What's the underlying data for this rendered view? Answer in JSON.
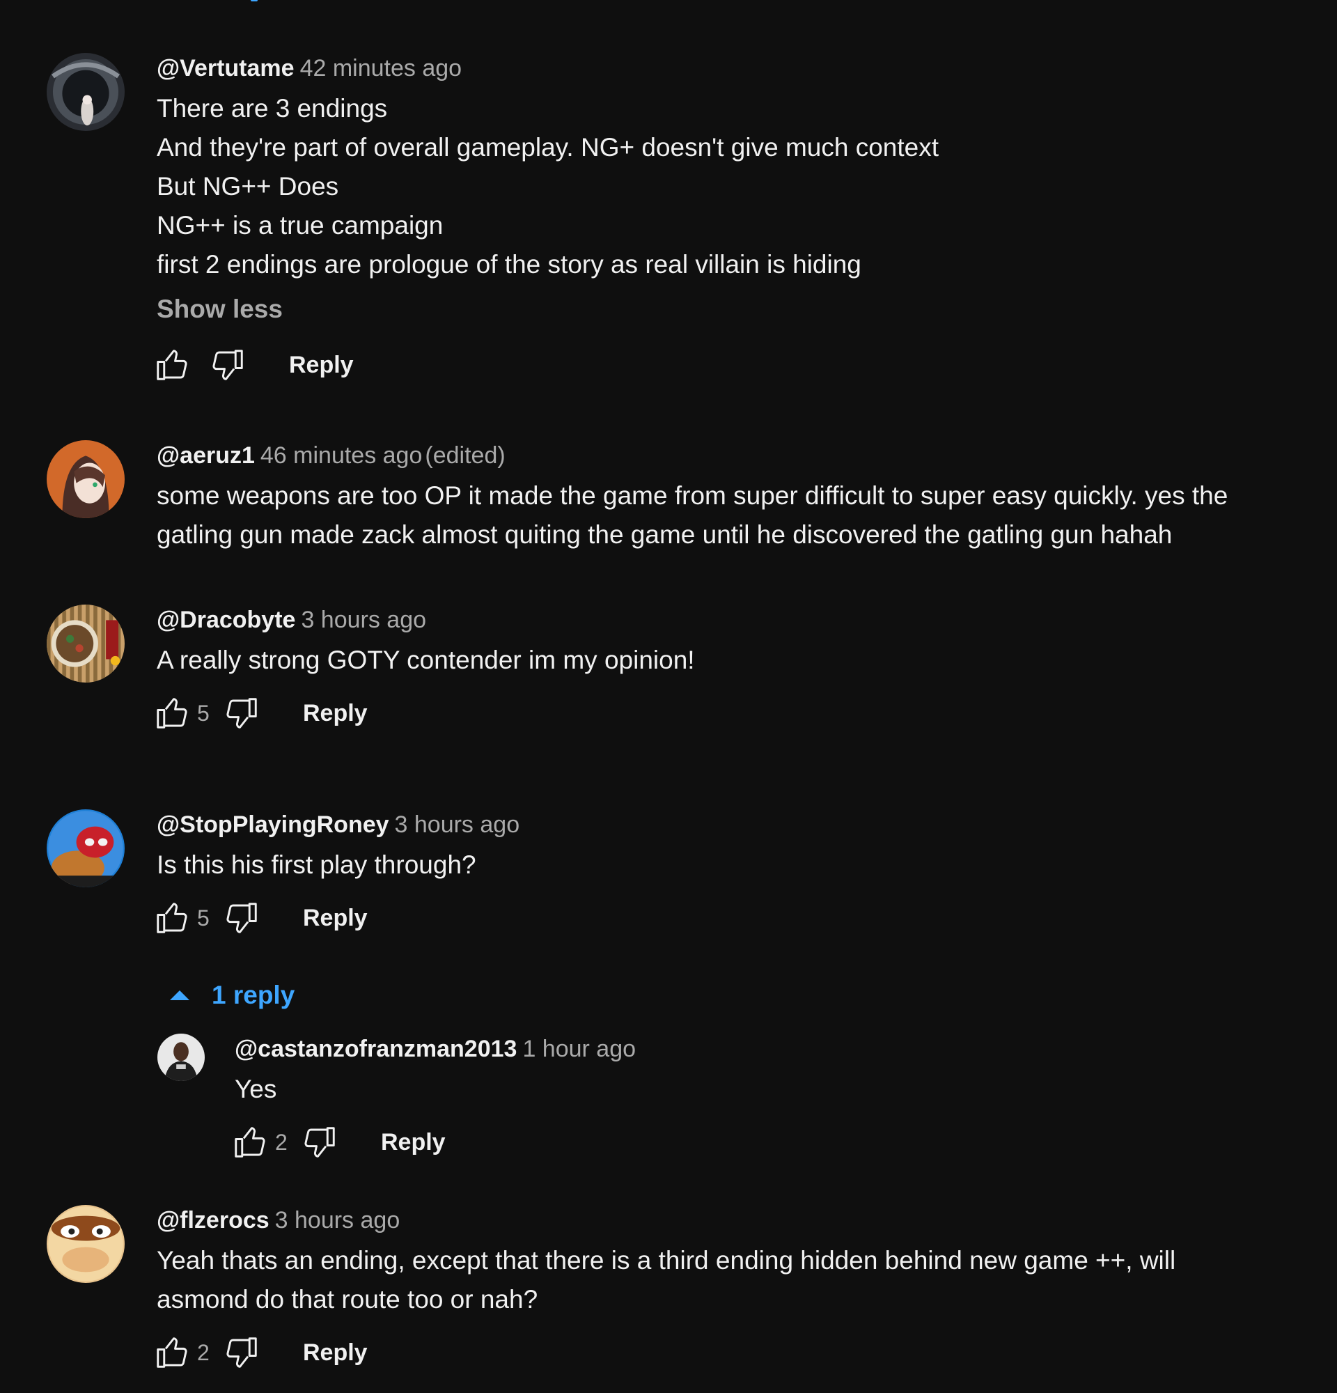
{
  "comments": [
    {
      "author": "@Vertutame",
      "time": "42 minutes ago",
      "edited": "",
      "lines": [
        "There are 3 endings",
        "And they're part of overall gameplay. NG+ doesn't give much context",
        "But NG++ Does",
        "NG++ is a true campaign",
        "first 2 endings are prologue of the story as real villain is hiding"
      ],
      "show_less": "Show less",
      "likes": "",
      "reply_label": "Reply"
    },
    {
      "author": "@aeruz1",
      "time": "46 minutes ago",
      "edited": "(edited)",
      "lines": [
        "some weapons are too OP it made the game from super difficult to super easy quickly. yes the",
        "gatling gun made zack almost quiting the game until he discovered the gatling gun hahah"
      ]
    },
    {
      "author": "@Dracobyte",
      "time": "3 hours ago",
      "lines": [
        "A really strong GOTY contender im my opinion!"
      ],
      "likes": "5",
      "reply_label": "Reply"
    },
    {
      "author": "@StopPlayingRoney",
      "time": "3 hours ago",
      "lines": [
        "Is this his first play through?"
      ],
      "likes": "5",
      "reply_label": "Reply",
      "replies_toggle": "1 reply",
      "replies": [
        {
          "author": "@castanzofranzman2013",
          "time": "1 hour ago",
          "lines": [
            "Yes"
          ],
          "likes": "2",
          "reply_label": "Reply"
        }
      ]
    },
    {
      "author": "@flzerocs",
      "time": "3 hours ago",
      "lines": [
        "Yeah thats an ending, except that there is a third ending hidden behind new game ++, will",
        "asmond do that route too or nah?"
      ],
      "likes": "2",
      "reply_label": "Reply"
    }
  ],
  "colors": {
    "background": "#0f0f0f",
    "text": "#f1f1f1",
    "secondary": "#aaaaaa",
    "link_blue": "#3ea6ff"
  },
  "icons": {
    "like": "thumb-up-icon",
    "dislike": "thumb-down-icon",
    "collapse": "caret-up-icon"
  }
}
